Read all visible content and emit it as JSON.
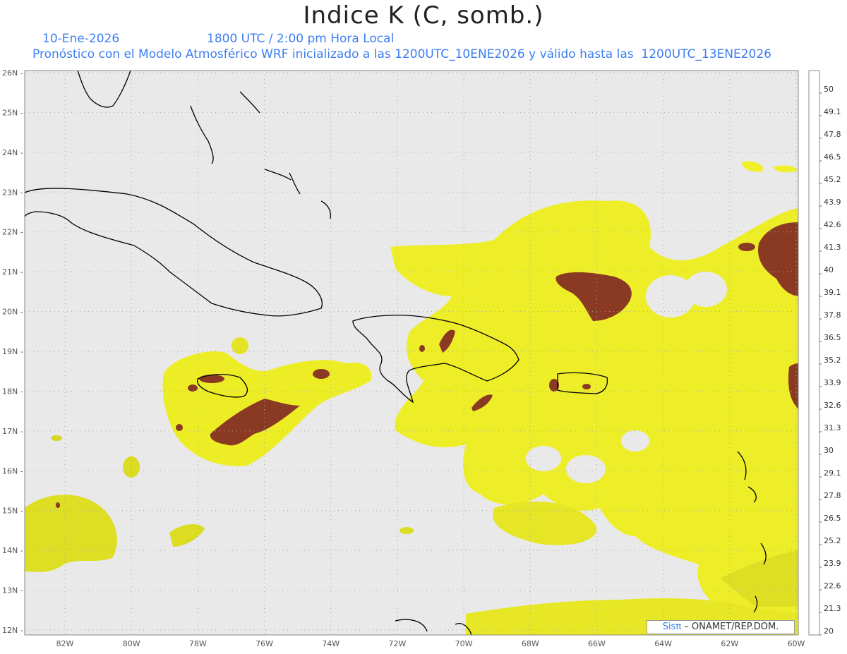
{
  "header": {
    "title": "Indice K (C, somb.)",
    "date": "10-Ene-2026",
    "time": "1800 UTC / 2:00 pm Hora Local",
    "description": "Pronóstico con el Modelo Atmosférico WRF inicializado a las 1200UTC_10ENE2026 y válido hasta las  1200UTC_13ENE2026"
  },
  "axes": {
    "lat_labels": [
      "26N",
      "25N",
      "24N",
      "23N",
      "22N",
      "21N",
      "20N",
      "19N",
      "18N",
      "17N",
      "16N",
      "15N",
      "14N",
      "13N",
      "12N"
    ],
    "lon_labels": [
      "82W",
      "80W",
      "78W",
      "76W",
      "74W",
      "72W",
      "70W",
      "68W",
      "66W",
      "64W",
      "62W",
      "60W"
    ]
  },
  "colorbar": {
    "labels": [
      "50",
      "49.1",
      "47.8",
      "46.5",
      "45.2",
      "43.9",
      "42.6",
      "41.3",
      "40",
      "39.1",
      "37.8",
      "36.5",
      "35.2",
      "33.9",
      "32.6",
      "31.3",
      "30",
      "29.1",
      "27.8",
      "26.5",
      "25.2",
      "23.9",
      "22.6",
      "21.3",
      "20"
    ],
    "colors": [
      "#5b0060",
      "#6b007a",
      "#7e0090",
      "#9100a8",
      "#a400c0",
      "#bc00d2",
      "#d200e0",
      "#e600ec",
      "#ff00ff",
      "#f09090",
      "#e38179",
      "#d8715f",
      "#cf6450",
      "#c25845",
      "#b54a38",
      "#a33a28",
      "#8e2a18",
      "#ffff20",
      "#f6f622",
      "#ecec25",
      "#e1e127",
      "#d6d629",
      "#cbcb1c",
      "#c0c000",
      "#eaeaea"
    ]
  },
  "credit": {
    "sis": "Sisπ",
    "rest": " – ONAMET/REP.DOM."
  },
  "legend_colors": {
    "background": "#e9e9e9",
    "yellow": "#f0f02a",
    "brown": "#8a3a22",
    "grid": "#a8a8a8",
    "coast": "#000000"
  }
}
